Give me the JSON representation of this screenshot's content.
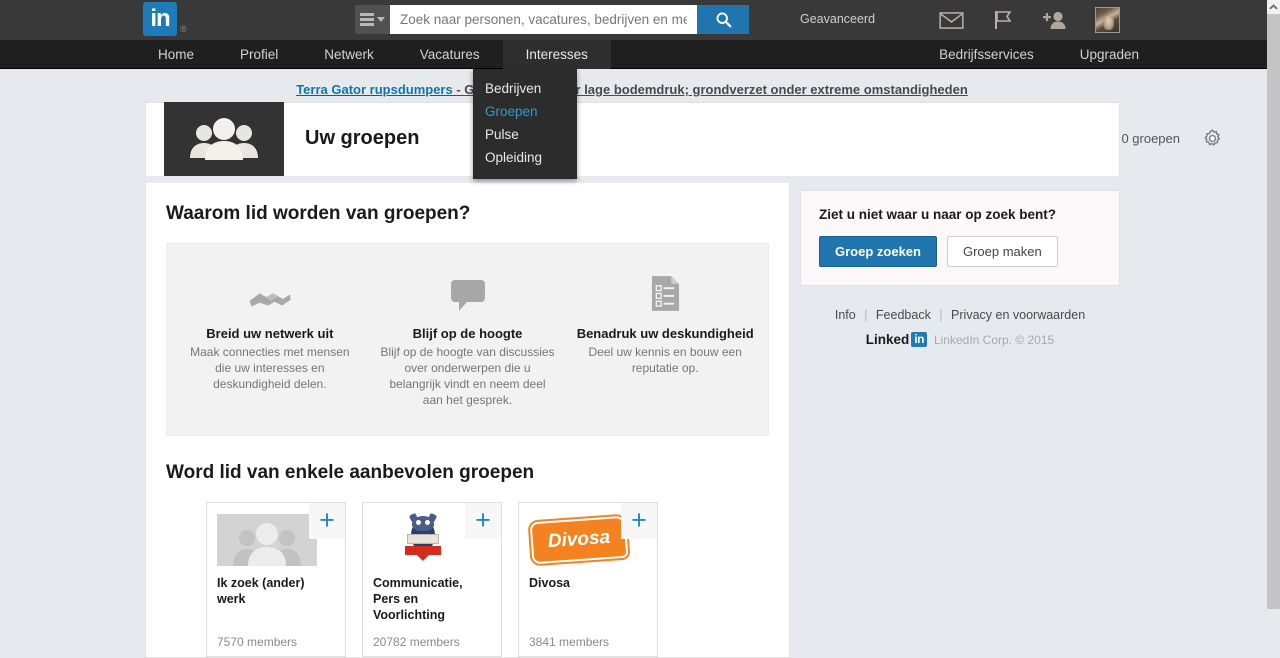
{
  "brand": {
    "logo_text": "in",
    "registered": "®",
    "accent": "#1c7bb8",
    "dark": "#393939"
  },
  "topbar": {
    "search": {
      "placeholder": "Zoek naar personen, vacatures, bedrijven en meer",
      "value": "",
      "type_icon": "hamburger-icon",
      "submit_icon": "search-icon"
    },
    "advanced_label": "Geavanceerd",
    "icons": [
      {
        "name": "mail-icon",
        "glyph": "envelope"
      },
      {
        "name": "flag-icon",
        "glyph": "flag"
      },
      {
        "name": "add-person-icon",
        "glyph": "person-plus"
      },
      {
        "name": "profile-avatar",
        "glyph": "avatar"
      }
    ]
  },
  "nav": {
    "left": [
      {
        "label": "Home",
        "active": false
      },
      {
        "label": "Profiel",
        "active": false
      },
      {
        "label": "Netwerk",
        "active": false
      },
      {
        "label": "Vacatures",
        "active": false
      },
      {
        "label": "Interesses",
        "active": true
      }
    ],
    "right": [
      {
        "label": "Bedrijfsservices"
      },
      {
        "label": "Upgraden"
      }
    ]
  },
  "dropdown": {
    "items": [
      {
        "label": "Bedrijven",
        "selected": false
      },
      {
        "label": "Groepen",
        "selected": true
      },
      {
        "label": "Pulse",
        "selected": false
      },
      {
        "label": "Opleiding",
        "selected": false
      }
    ]
  },
  "ad": {
    "link_text": "Terra Gator rupsdumpers",
    "separator": " - ",
    "body_text": "Grote banden voor lage bodemdruk; grondverzet onder extreme omstandigheden"
  },
  "page_header": {
    "icon": "groups-icon",
    "title": "Uw groepen",
    "count_label": "0 groepen",
    "settings_icon": "gear-icon"
  },
  "benefits_section": {
    "title": "Waarom lid worden van groepen?",
    "items": [
      {
        "icon": "handshake-icon",
        "heading": "Breid uw netwerk uit",
        "body": "Maak connecties met mensen die uw interesses en deskundigheid delen."
      },
      {
        "icon": "speech-bubble-icon",
        "heading": "Blijf op de hoogte",
        "body": "Blijf op de hoogte van discussies over onderwerpen die u belangrijk vindt en neem deel aan het gesprek."
      },
      {
        "icon": "checklist-document-icon",
        "heading": "Benadruk uw deskundigheid",
        "body": "Deel uw kennis en bouw een reputatie op."
      }
    ]
  },
  "recommended_section": {
    "title": "Word lid van enkele aanbevolen groepen",
    "join_icon": "plus-icon",
    "cards": [
      {
        "name": "Ik zoek (ander) werk",
        "members": "7570 members",
        "logo": "generic-group-placeholder"
      },
      {
        "name": "Communicatie, Pers en Voorlichting",
        "members": "20782 members",
        "logo": "owl-logo"
      },
      {
        "name": "Divosa",
        "members": "3841 members",
        "logo": "divosa-logo",
        "logo_text": "Divosa"
      }
    ]
  },
  "sidebar": {
    "prompt": "Ziet u niet waar u naar op zoek bent?",
    "search_button": "Groep zoeken",
    "create_button": "Groep maken",
    "footer_links": [
      "Info",
      "Feedback",
      "Privacy en voorwaarden"
    ],
    "footer_brand": {
      "word": "Linked",
      "badge": "in"
    },
    "copyright": "LinkedIn Corp. © 2015"
  },
  "scrollbar": {
    "up_arrow_icon": "chevron-up-icon"
  }
}
